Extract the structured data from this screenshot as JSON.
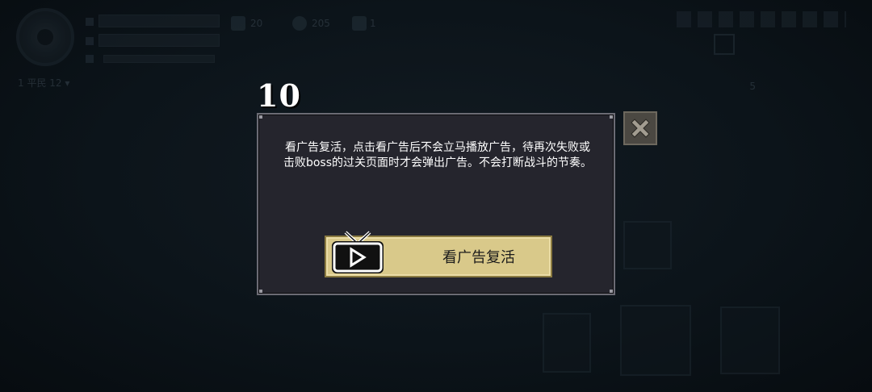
{
  "countdown": "10",
  "dialog": {
    "message": "看广告复活，点击看广告后不会立马播放广告，待再次失败或击败boss的过关页面时才会弹出广告。不会打断战斗的节奏。",
    "ad_button_label": "看广告复活"
  },
  "background_hud": {
    "level_text": "1 平民 12 ▾",
    "resource_1": "20",
    "resource_2": "205",
    "resource_3": "1",
    "skull_count": "5"
  },
  "icons": {
    "tv": "tv-play-icon",
    "close": "close-x-icon"
  },
  "colors": {
    "dialog_bg": "#25252d",
    "button_bg": "#d9c98a",
    "close_bg": "#4b4842",
    "page_bg": "#0b1218"
  }
}
